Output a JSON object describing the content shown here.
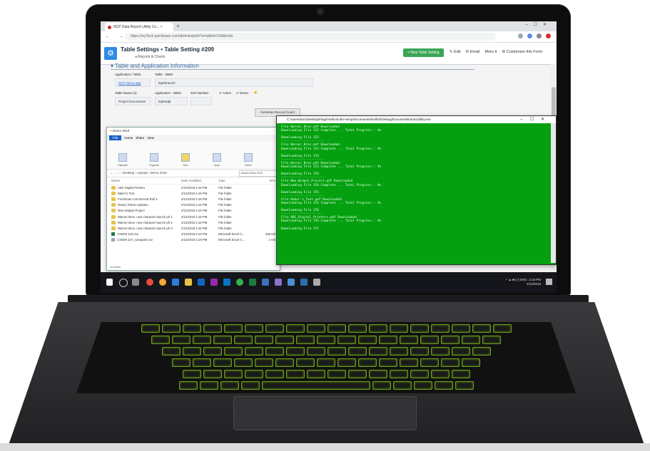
{
  "browser": {
    "tab_title": "NCP Data Report Utility Co... ×",
    "url": "https://myTech.quickbase.com/db/bmkdjn6b?a=td&tid=209&t=dis"
  },
  "app": {
    "title": "Table Settings • Table Setting #209",
    "subtitle": "◂ Reports & Charts",
    "new_button": "+ New Table Setting",
    "edit": "Edit",
    "email": "Email",
    "more": "More ▾",
    "customize": "Customize this Form",
    "section_title": "Table and Application Information",
    "fields": {
      "app_table_label": "Application / Table",
      "app_table_value": "NCP Demo app",
      "table_dbid_label": "Table - DBID",
      "table_dbid_value": "bq2dmev23",
      "table_name_label": "Table Name (s)",
      "table_name_value": "Project Documents",
      "app_dbid_label": "Application - DBID",
      "app_dbid_value": "bq9mdjd",
      "sort_label": "Sort Number",
      "active_label": "✔ Active",
      "demo_label": "✔ Demo"
    },
    "generate_button": "Generate Record Count"
  },
  "explorer": {
    "title": "Demo 2019",
    "ribbon_tabs": [
      "File",
      "Home",
      "Share",
      "View"
    ],
    "ribbon_groups": [
      "Pin to Quick access",
      "Copy",
      "Paste",
      "Move to",
      "Copy to",
      "Delete",
      "Rename",
      "New folder",
      "Properties",
      "Open",
      "Select all"
    ],
    "ribbon_sections": [
      "Clipboard",
      "Organize",
      "New",
      "Open",
      "Select"
    ],
    "path": "← → ↑  › Desktop › Upload › Demo 2019",
    "search_placeholder": "Search Demo 2019",
    "columns": [
      "Name",
      "Date modified",
      "Type",
      "Size"
    ],
    "rows": [
      {
        "name": "ABC Digital Printers",
        "date": "2/12/2019 2:18 PM",
        "type": "File folder",
        "size": "",
        "kind": "folder"
      },
      {
        "name": "Baker's Tent",
        "date": "2/12/2019 2:18 PM",
        "type": "File folder",
        "size": "",
        "kind": "folder"
      },
      {
        "name": "Freshman Commercial Roll 2",
        "date": "2/12/2019 2:18 PM",
        "type": "File folder",
        "size": "",
        "kind": "folder"
      },
      {
        "name": "Mowry Robot Updates",
        "date": "2/12/2019 2:18 PM",
        "type": "File folder",
        "size": "",
        "kind": "folder"
      },
      {
        "name": "New Widget Project",
        "date": "2/12/2019 2:18 PM",
        "type": "File folder",
        "size": "",
        "kind": "folder"
      },
      {
        "name": "Warner Bros. new character launch ph 1",
        "date": "2/12/2019 2:18 PM",
        "type": "File folder",
        "size": "",
        "kind": "folder"
      },
      {
        "name": "Warner Bros. new character launch ph 2",
        "date": "2/12/2019 2:18 PM",
        "type": "File folder",
        "size": "",
        "kind": "folder"
      },
      {
        "name": "Warner Bros. new character launch ph 3",
        "date": "2/12/2019 2:18 PM",
        "type": "File folder",
        "size": "",
        "kind": "folder"
      },
      {
        "name": "CSD09 122.csv",
        "date": "2/12/2019 2:18 PM",
        "type": "Microsoft Excel C...",
        "size": "256 KB",
        "kind": "xls"
      },
      {
        "name": "CSD09 127_computer.csv",
        "date": "2/12/2019 2:18 PM",
        "type": "Microsoft Excel C...",
        "size": "1 KB",
        "kind": "csv"
      }
    ],
    "status": "10 items"
  },
  "console": {
    "title": "C:\\Users\\trac\\Desktop\\Flagx\\nethost-dev-temp\\Documents\\test\\bin\\Debug\\DocumentExtractUtility.exe",
    "lines": [
      "File Warner_Bros.pdf Downloaded",
      "Downloading File 153 Complete ... Total Progress : 4%",
      "",
      "Downloading File 153",
      "-----------------------",
      "File Warner_Bros.pdf Downloaded",
      "Downloading File 153 Complete ... Total Progress : 4%",
      "",
      "Downloading File 153",
      "-----------------------",
      "File Warner_Bros.pdf Downloaded",
      "Downloading File 153 Complete ... Total Progress : 4%",
      "",
      "Downloading File 154",
      "-----------------------",
      "File New_Widget_Project.pdf Downloaded",
      "Downloading File 154 Complete ... Total Progress : 4%",
      "",
      "Downloading File 155",
      "-----------------------",
      "File Baker's_Tent.pdf Downloaded",
      "Downloading File 155 Complete ... Total Progress : 4%",
      "",
      "Downloading File 156",
      "-----------------------",
      "File ABC_Digital_Printers.pdf Downloaded",
      "Downloading File 156 Complete ... Total Progress : 4%",
      "",
      "Downloading File 157"
    ]
  },
  "taskbar": {
    "time": "2:18 PM",
    "date": "2/12/2019",
    "tray": "^ ▲ ■ (») ENG"
  },
  "colors": {
    "console_bg": "#04a00f",
    "keyboard_backlight": "#6ea21c",
    "app_accent": "#2f8be6",
    "new_button": "#3aa655"
  }
}
